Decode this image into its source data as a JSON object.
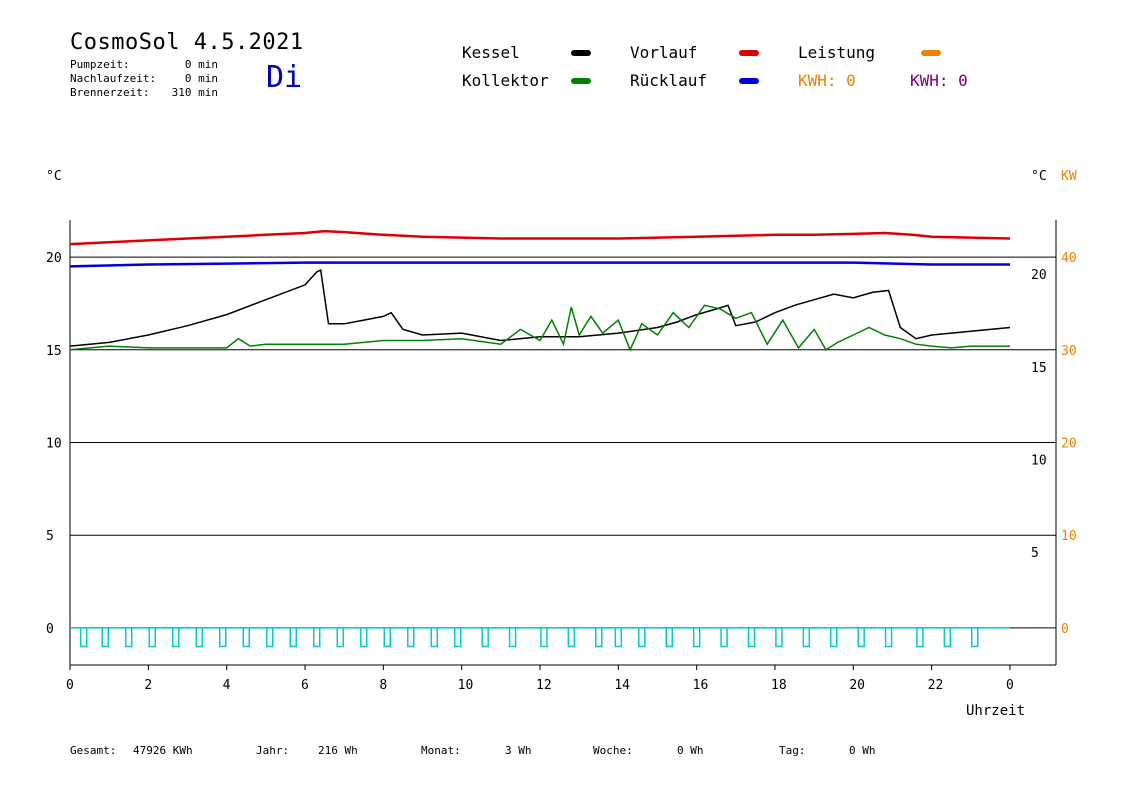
{
  "header": {
    "title": "CosmoSol 4.5.2021",
    "day": "Di",
    "info": [
      {
        "label": "Pumpzeit:",
        "value": "0 min"
      },
      {
        "label": "Nachlaufzeit:",
        "value": "0 min"
      },
      {
        "label": "Brennerzeit:",
        "value": "310 min"
      }
    ]
  },
  "legend": {
    "kessel": {
      "label": "Kessel",
      "color": "#000000"
    },
    "kollektor": {
      "label": "Kollektor",
      "color": "#008000"
    },
    "vorlauf": {
      "label": "Vorlauf",
      "color": "#dd0000"
    },
    "ruecklauf": {
      "label": "Rücklauf",
      "color": "#0000dd"
    },
    "leistung": {
      "label": "Leistung",
      "color": "#f08000"
    },
    "kwh_orange": {
      "label": "KWH: 0",
      "color": "#f08000"
    },
    "kwh_purple": {
      "label": "KWH: 0",
      "color": "#800080"
    }
  },
  "footer": [
    {
      "label": "Gesamt:",
      "value": "47926 KWh"
    },
    {
      "label": "Jahr:",
      "value": "216 Wh"
    },
    {
      "label": "Monat:",
      "value": "3 Wh"
    },
    {
      "label": "Woche:",
      "value": "0 Wh"
    },
    {
      "label": "Tag:",
      "value": "0 Wh"
    }
  ],
  "chart_data": {
    "type": "line",
    "xlabel": "Uhrzeit",
    "ylabel_left": "°C",
    "ylabel_right": "°C",
    "ylabel_right2": "KW",
    "x_ticks": [
      "0",
      "2",
      "4",
      "6",
      "8",
      "10",
      "12",
      "14",
      "16",
      "18",
      "20",
      "22",
      "0"
    ],
    "x_range": [
      0,
      24
    ],
    "y_range": [
      -2,
      22
    ],
    "y_left_ticks": [
      0,
      5,
      10,
      15,
      20
    ],
    "y_right_ticks": [
      5,
      10,
      15,
      20
    ],
    "y_right_kw_ticks": [
      0,
      10,
      20,
      30,
      40
    ],
    "grid_lines_y": [
      0,
      5,
      10,
      15,
      20
    ],
    "series": [
      {
        "name": "Vorlauf",
        "color": "#dd0000",
        "x": [
          0,
          1,
          2,
          3,
          4,
          5,
          6,
          6.5,
          7,
          8,
          9,
          10,
          11,
          12,
          13,
          14,
          15,
          16,
          17,
          18,
          19,
          20,
          20.8,
          21.5,
          22,
          23,
          24
        ],
        "y": [
          20.7,
          20.8,
          20.9,
          21.0,
          21.1,
          21.2,
          21.3,
          21.4,
          21.35,
          21.2,
          21.1,
          21.05,
          21.0,
          21.0,
          21.0,
          21.0,
          21.05,
          21.1,
          21.15,
          21.2,
          21.2,
          21.25,
          21.3,
          21.2,
          21.1,
          21.05,
          21.0
        ]
      },
      {
        "name": "Rücklauf",
        "color": "#0000dd",
        "x": [
          0,
          2,
          4,
          6,
          8,
          10,
          12,
          14,
          16,
          18,
          20,
          22,
          24
        ],
        "y": [
          19.5,
          19.6,
          19.65,
          19.7,
          19.7,
          19.7,
          19.7,
          19.7,
          19.7,
          19.7,
          19.7,
          19.6,
          19.6
        ],
        "y_unit": "°C"
      },
      {
        "name": "Kessel",
        "color": "#000000",
        "x": [
          0,
          1,
          2,
          3,
          4,
          5,
          6,
          6.3,
          6.4,
          6.6,
          7,
          7.5,
          8,
          8.2,
          8.5,
          9,
          10,
          11,
          12,
          13,
          14,
          15,
          15.5,
          16,
          16.5,
          16.8,
          17,
          17.5,
          18,
          18.5,
          19,
          19.5,
          20,
          20.5,
          20.9,
          21.2,
          21.6,
          22,
          23,
          24
        ],
        "y": [
          15.2,
          15.4,
          15.8,
          16.3,
          16.9,
          17.7,
          18.5,
          19.2,
          19.3,
          16.4,
          16.4,
          16.6,
          16.8,
          17.0,
          16.1,
          15.8,
          15.9,
          15.5,
          15.7,
          15.7,
          15.9,
          16.2,
          16.5,
          16.9,
          17.2,
          17.4,
          16.3,
          16.5,
          17.0,
          17.4,
          17.7,
          18.0,
          17.8,
          18.1,
          18.2,
          16.2,
          15.6,
          15.8,
          16.0,
          16.2
        ]
      },
      {
        "name": "Kollektor",
        "color": "#008000",
        "x": [
          0,
          0.5,
          1,
          2,
          3,
          4,
          4.3,
          4.6,
          5,
          6,
          7,
          8,
          9,
          10,
          11,
          11.5,
          12,
          12.3,
          12.6,
          12.8,
          13,
          13.3,
          13.6,
          14,
          14.3,
          14.6,
          15,
          15.4,
          15.8,
          16.2,
          16.6,
          17,
          17.4,
          17.8,
          18.2,
          18.6,
          19,
          19.3,
          19.6,
          20,
          20.4,
          20.8,
          21.2,
          21.6,
          22,
          22.5,
          23,
          24
        ],
        "y": [
          15.0,
          15.1,
          15.2,
          15.1,
          15.1,
          15.1,
          15.6,
          15.2,
          15.3,
          15.3,
          15.3,
          15.5,
          15.5,
          15.6,
          15.3,
          16.1,
          15.5,
          16.6,
          15.3,
          17.3,
          15.8,
          16.8,
          15.9,
          16.6,
          15.0,
          16.4,
          15.8,
          17.0,
          16.2,
          17.4,
          17.2,
          16.7,
          17.0,
          15.3,
          16.6,
          15.1,
          16.1,
          15.0,
          15.4,
          15.8,
          16.2,
          15.8,
          15.6,
          15.3,
          15.2,
          15.1,
          15.2,
          15.2
        ]
      },
      {
        "name": "Pumpe",
        "color": "#00cccc",
        "x": [
          0.35,
          0.9,
          1.5,
          2.1,
          2.7,
          3.3,
          3.9,
          4.5,
          5.1,
          5.7,
          6.3,
          6.9,
          7.5,
          8.1,
          8.7,
          9.3,
          9.9,
          10.6,
          11.3,
          12.1,
          12.8,
          13.5,
          14,
          14.6,
          15.3,
          16.0,
          16.7,
          17.4,
          18.1,
          18.8,
          19.5,
          20.2,
          20.9,
          21.7,
          22.4,
          23.1
        ],
        "y": [
          -1,
          -1,
          -1,
          -1,
          -1,
          -1,
          -1,
          -1,
          -1,
          -1,
          -1,
          -1,
          -1,
          -1,
          -1,
          -1,
          -1,
          -1,
          -1,
          -1,
          -1,
          -1,
          -1,
          -1,
          -1,
          -1,
          -1,
          -1,
          -1,
          -1,
          -1,
          -1,
          -1,
          -1,
          -1,
          -1
        ],
        "baseline": 0
      }
    ]
  }
}
